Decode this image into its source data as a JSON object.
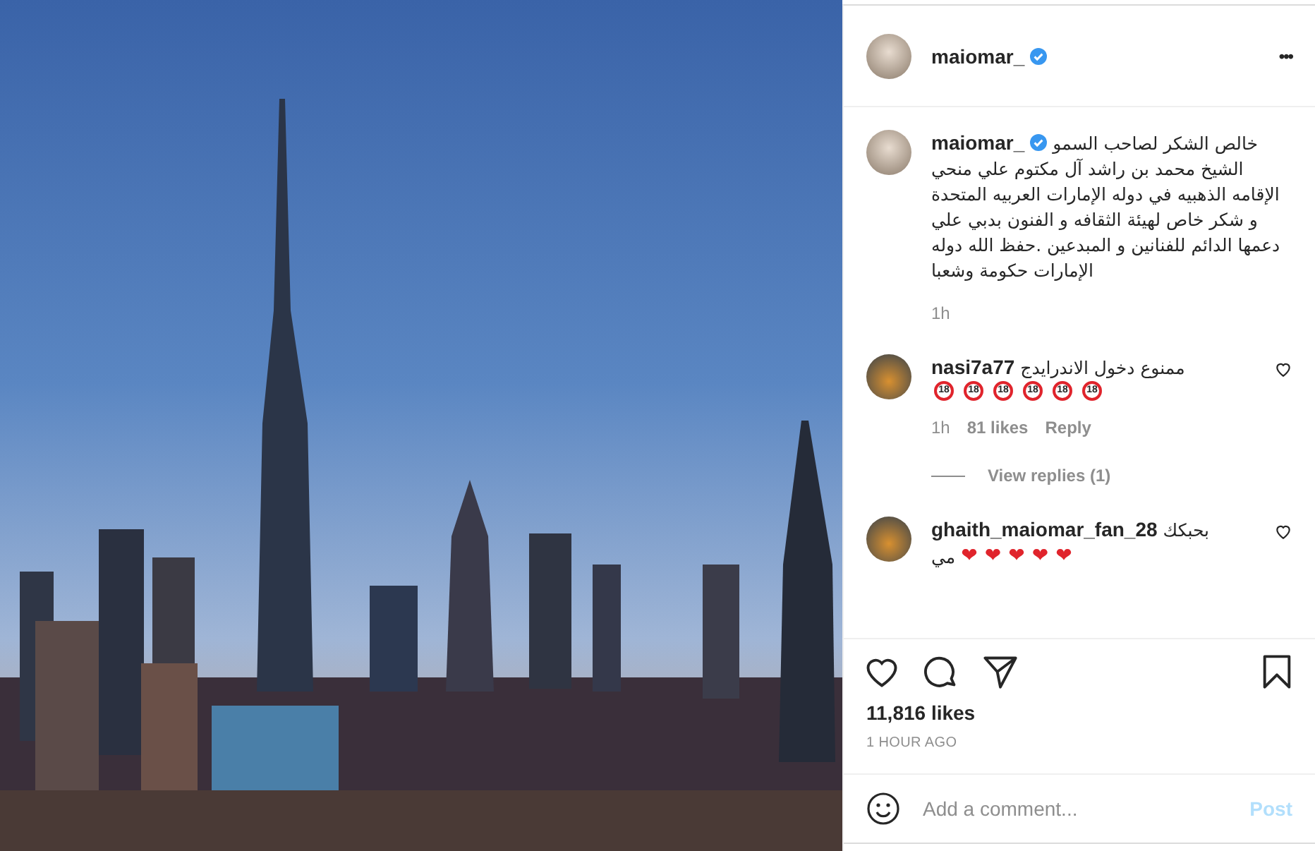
{
  "post": {
    "username": "maiomar_",
    "verified": true,
    "more": "•••"
  },
  "caption": {
    "username": "maiomar_",
    "verified": true,
    "text": "خالص الشكر لصاحب السمو الشيخ محمد بن راشد آل مكتوم علي منحي الإقامه الذهبيه في دوله الإمارات العربيه المتحدة و شكر خاص لهيئة الثقافه و الفنون بدبي علي دعمها الدائم للفنانين و المبدعين .حفظ الله دوله الإمارات حكومة وشعبا",
    "time": "1h"
  },
  "comments": [
    {
      "username": "nasi7a77",
      "text": "ممنوع دخول الاندرايدج",
      "parts": [
        {
          "kind": "no18",
          "text": "18"
        },
        {
          "kind": "no18",
          "text": "18"
        },
        {
          "kind": "no18",
          "text": "18"
        },
        {
          "kind": "no18",
          "text": "18"
        },
        {
          "kind": "no18",
          "text": "18"
        },
        {
          "kind": "no18",
          "text": "18"
        }
      ],
      "time": "1h",
      "likes": "81 likes",
      "reply": "Reply",
      "view_replies": "View replies (1)"
    },
    {
      "username": "ghaith_maiomar_fan_28",
      "text": "بحبكك",
      "parts": [
        {
          "kind": "heart",
          "text": "❤"
        },
        {
          "kind": "heart",
          "text": "❤"
        },
        {
          "kind": "heart",
          "text": "❤"
        },
        {
          "kind": "heart",
          "text": "❤"
        },
        {
          "kind": "heart",
          "text": "❤"
        },
        {
          "kind": "text",
          "text": "مي"
        }
      ]
    }
  ],
  "likes": "11,816 likes",
  "posted": "1 HOUR AGO",
  "comment_field": {
    "placeholder": "Add a comment...",
    "post_button": "Post"
  }
}
